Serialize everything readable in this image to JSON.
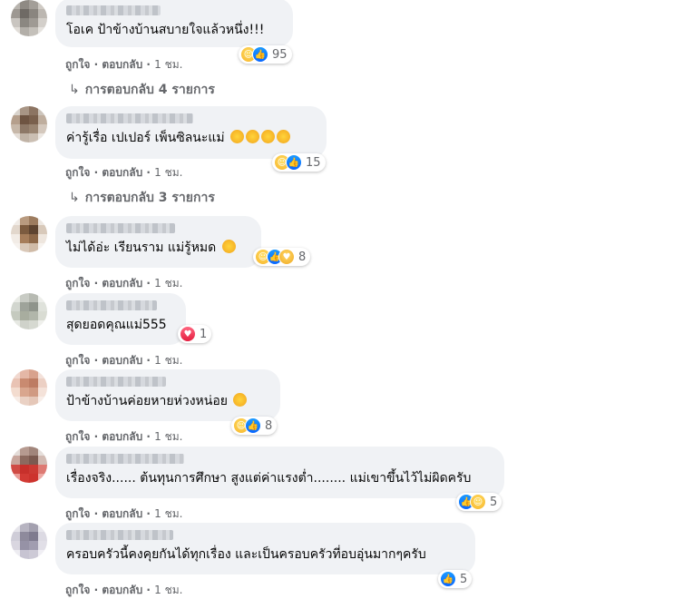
{
  "actions": {
    "like": "ถูกใจ",
    "reply": "ตอบกลับ",
    "sep": " · ",
    "time": "1 ชม."
  },
  "comments": [
    {
      "text": "โอเค ป้าข้างบ้านสบายใจแล้วหนึ่ง!!!",
      "reaction_count": "95",
      "reactions": [
        "haha",
        "like"
      ],
      "replies": "การตอบกลับ 4 รายการ"
    },
    {
      "text": "ค่ารู้เรื่อ เปเปอร์ เพ็นซิลนะแม่",
      "inline_emojis": [
        "rofl",
        "rofl",
        "rofl",
        "rofl"
      ],
      "reaction_count": "15",
      "reactions": [
        "haha",
        "like"
      ],
      "replies": "การตอบกลับ 3 รายการ"
    },
    {
      "text": "ไม่ได้อ่ะ เรียนราม แม่รู้หมด",
      "inline_emojis": [
        "smile"
      ],
      "reaction_count": "8",
      "reactions": [
        "haha",
        "like",
        "care"
      ]
    },
    {
      "text": "สุดยอดคุณแม่555",
      "reaction_count": "1",
      "reactions": [
        "love"
      ]
    },
    {
      "text": "ป้าข้างบ้านค่อยหายห่วงหน่อย",
      "inline_emojis": [
        "grin"
      ],
      "reaction_count": "8",
      "reactions": [
        "haha",
        "like"
      ]
    },
    {
      "text": "เรื่องจริง...... ต้นทุนการศึกษา สูงแต่ค่าแรงต่ำ........ แม่เขาขึ้นไว้ไม่ผิดครับ",
      "reaction_count": "5",
      "reactions": [
        "like",
        "haha"
      ]
    },
    {
      "text": "ครอบครัวนี้คงคุยกันได้ทุกเรื่อง และเป็นครอบครัวที่อบอุ่นมากๆครับ",
      "reaction_count": "5",
      "reactions": [
        "like"
      ]
    }
  ],
  "colors": {
    "bubble": "#f0f2f5",
    "meta": "#65676b",
    "like": "#0866ff",
    "love": "#e41e3f",
    "haha": "#f7b125"
  }
}
